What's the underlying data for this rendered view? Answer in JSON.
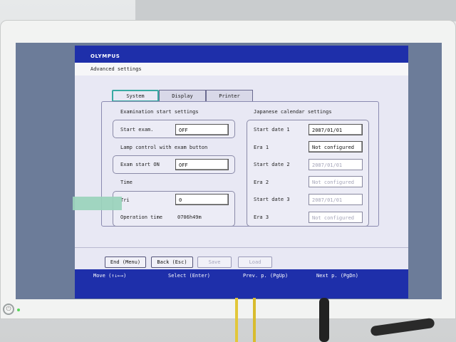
{
  "app": {
    "brand": "OLYMPUS",
    "screen_title": "Advanced settings"
  },
  "tabs": [
    {
      "label": "System",
      "active": true
    },
    {
      "label": "Display",
      "active": false
    },
    {
      "label": "Printer",
      "active": false
    }
  ],
  "left": {
    "exam_start": {
      "heading": "Examination start settings",
      "label": "Start exam.",
      "value": "OFF"
    },
    "lamp": {
      "heading": "Lamp control with exam button",
      "label": "Exam start ON",
      "value": "OFF"
    },
    "time": {
      "heading": "Time",
      "partial_label": "Tri",
      "value": "0",
      "operation_label": "Operation time",
      "operation_value": "0706h49m"
    }
  },
  "right": {
    "heading": "Japanese calendar settings",
    "rows": [
      {
        "label": "Start date 1",
        "value": "2087/01/01",
        "enabled": true
      },
      {
        "label": "Era 1",
        "value": "Not configured",
        "enabled": true
      },
      {
        "label": "Start date 2",
        "value": "2087/01/01",
        "enabled": false
      },
      {
        "label": "Era 2",
        "value": "Not configured",
        "enabled": false
      },
      {
        "label": "Start date 3",
        "value": "2087/01/01",
        "enabled": false
      },
      {
        "label": "Era 3",
        "value": "Not configured",
        "enabled": false
      }
    ]
  },
  "buttons": {
    "end": "End (Menu)",
    "back": "Back (Esc)",
    "save": "Save",
    "load": "Load"
  },
  "hints": {
    "move": "Move (↑↓←→)",
    "select": "Select (Enter)",
    "prev": "Prev. p. (PgUp)",
    "next": "Next p. (PgDn)"
  },
  "colors": {
    "header_blue": "#1e2faa",
    "panel_bg": "#e8e8f4",
    "active_tab_border": "#3aa9a3"
  }
}
